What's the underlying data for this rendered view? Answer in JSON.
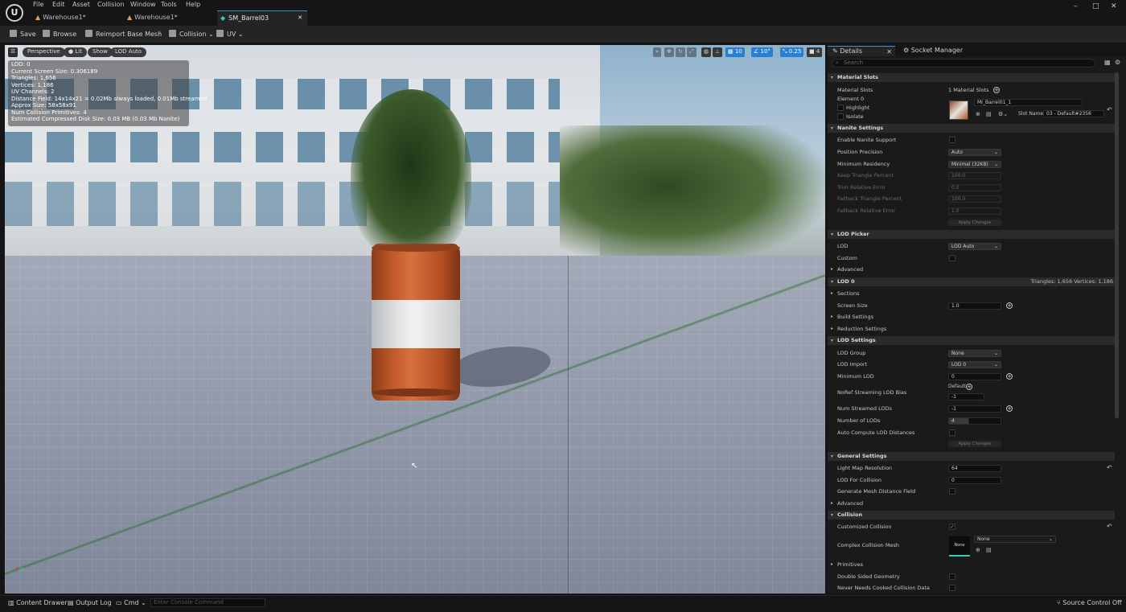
{
  "menu": [
    "File",
    "Edit",
    "Asset",
    "Collision",
    "Window",
    "Tools",
    "Help"
  ],
  "doc_tabs": [
    "Warehouse1*",
    "Warehouse1*",
    "SM_Barrel03"
  ],
  "window_controls": {
    "minimize": "–",
    "maximize": "□",
    "close": "✕"
  },
  "toolbar": {
    "save": "Save",
    "browse": "Browse",
    "reimport": "Reimport Base Mesh",
    "collision": "Collision",
    "uv": "UV"
  },
  "viewport": {
    "pills": [
      "Perspective",
      "Lit",
      "Show",
      "LOD Auto"
    ],
    "tools": {
      "grid": "10",
      "angle": "10°",
      "scale": "0.25",
      "cam": "4"
    },
    "stats": [
      "LOD:  0",
      "Current Screen Size:  0.306189",
      "Triangles:  1,656",
      "Vertices:  1,186",
      "UV Channels:  2",
      "Distance Field:  14x14x21 = 0.02Mb always loaded, 0.01Mb streamed",
      "Approx Size: 58x58x91",
      "Num Collision Primitives:  4",
      "Estimated Compressed Disk Size: 0.03 MB (0.03 Mb Nanite)"
    ]
  },
  "details": {
    "tabs": [
      "Details",
      "Socket Manager"
    ],
    "search_placeholder": "Search",
    "material_slots": {
      "header": "Material Slots",
      "label": "Material Slots",
      "count": "1 Material Slots",
      "element": "Element 0",
      "highlight": "Highlight",
      "isolate": "Isolate",
      "material_name": "MI_Barrel01_1",
      "slot_name_label": "Slot Name",
      "slot_name": "03 - Default#2356"
    },
    "nanite": {
      "header": "Nanite Settings",
      "enable": "Enable Nanite Support",
      "position_precision": "Position Precision",
      "position_precision_value": "Auto",
      "min_residency": "Minimum Residency",
      "min_residency_value": "Minimal (32KB)",
      "keep_triangle": "Keep Triangle Percent",
      "keep_triangle_value": "100.0",
      "trim_error": "Trim Relative Error",
      "trim_error_value": "0.0",
      "fallback_triangle": "Fallback Triangle Percent",
      "fallback_triangle_value": "100.0",
      "fallback_error": "Fallback Relative Error",
      "fallback_error_value": "1.0",
      "apply": "Apply Changes"
    },
    "lod_picker": {
      "header": "LOD Picker",
      "lod": "LOD",
      "lod_value": "LOD Auto",
      "custom": "Custom",
      "advanced": "Advanced"
    },
    "lod0": {
      "header": "LOD 0",
      "summary": "Triangles: 1,656    Vertices: 1,186",
      "sections": "Sections",
      "screen_size": "Screen Size",
      "screen_size_value": "1.0",
      "build": "Build Settings",
      "reduction": "Reduction Settings"
    },
    "lod_settings": {
      "header": "LOD Settings",
      "group": "LOD Group",
      "group_value": "None",
      "import": "LOD Import",
      "import_value": "LOD 0",
      "min_lod": "Minimum LOD",
      "min_lod_value": "0",
      "noref": "NoRef Streaming LOD Bias",
      "noref_default": "Default",
      "noref_value": "-1",
      "num_streamed": "Num Streamed LODs",
      "num_streamed_value": "-1",
      "num_lods": "Number of LODs",
      "num_lods_value": "4",
      "auto_compute": "Auto Compute LOD Distances",
      "apply": "Apply Changes"
    },
    "general": {
      "header": "General Settings",
      "lightmap": "Light Map Resolution",
      "lightmap_value": "64",
      "lod_collision": "LOD For Collision",
      "lod_collision_value": "0",
      "distance_field": "Generate Mesh Distance Field",
      "advanced": "Advanced"
    },
    "collision": {
      "header": "Collision",
      "customized": "Customized Collision",
      "complex_mesh": "Complex Collision Mesh",
      "complex_thumb": "None",
      "complex_value": "None",
      "primitives": "Primitives",
      "double_sided": "Double Sided Geometry",
      "never_cooked": "Never Needs Cooked Collision Data"
    }
  },
  "statusbar": {
    "content_drawer": "Content Drawer",
    "output_log": "Output Log",
    "cmd": "Cmd",
    "console_placeholder": "Enter Console Command",
    "source_control": "Source Control Off"
  },
  "colors": {
    "accent": "#2a7fd1",
    "panel": "#1a1a1a",
    "barrel_orange": "#c35a2a"
  }
}
